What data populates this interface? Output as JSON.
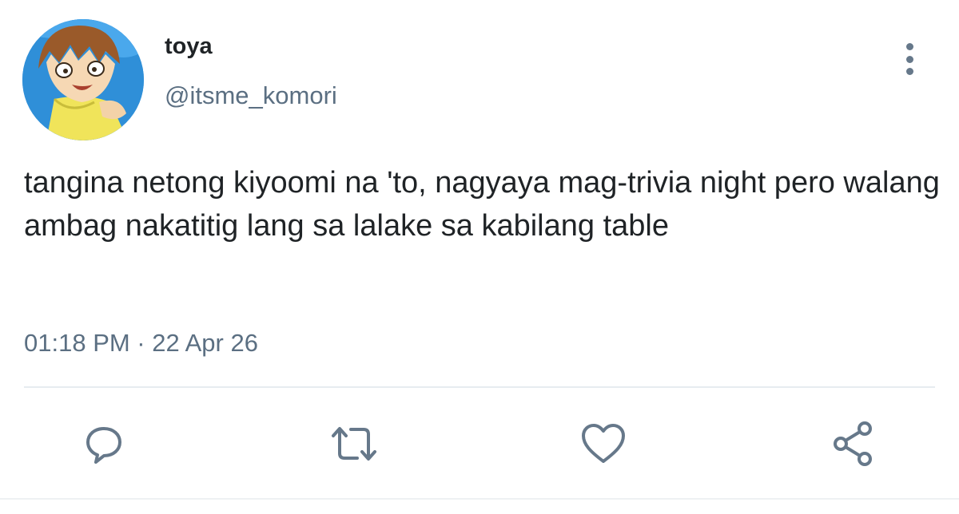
{
  "tweet": {
    "display_name": "toya",
    "handle": "@itsme_komori",
    "text": "tangina netong kiyoomi na 'to, nagyaya mag-trivia night pero walang ambag nakatitig lang sa lalake sa kabilang table",
    "timestamp": "01:18 PM · 22 Apr 26"
  },
  "actions": {
    "reply_icon": "speech-bubble-icon",
    "retweet_icon": "retweet-icon",
    "like_icon": "heart-icon",
    "share_icon": "share-icon",
    "more_icon": "vertical-ellipsis-icon"
  },
  "colors": {
    "text_primary": "#1f2326",
    "text_secondary": "#5b6f82",
    "icon": "#66788a",
    "divider": "#e6ecf0"
  }
}
